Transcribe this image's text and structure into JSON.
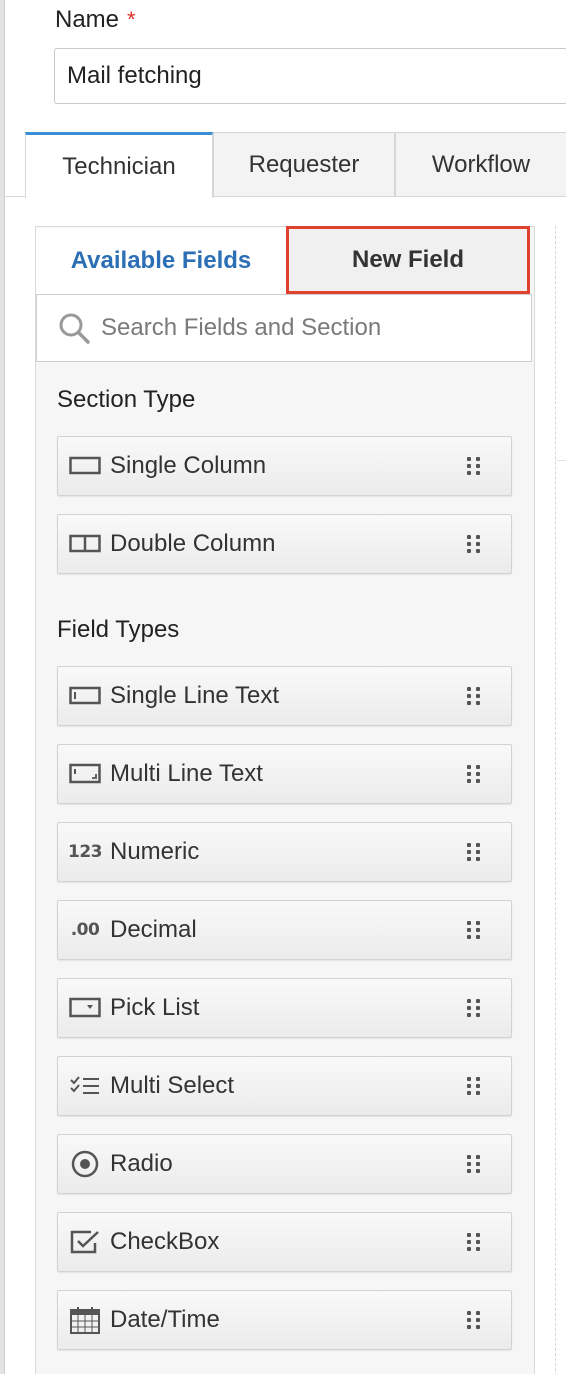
{
  "form": {
    "name_label": "Name",
    "required_marker": "*",
    "name_value": "Mail fetching"
  },
  "tabs": [
    {
      "label": "Technician",
      "active": true
    },
    {
      "label": "Requester",
      "active": false
    },
    {
      "label": "Workflow",
      "active": false
    }
  ],
  "panel": {
    "subtabs": {
      "available_fields": "Available Fields",
      "new_field": "New Field"
    },
    "highlight_color": "#e0412c",
    "link_color": "#2c6fb5",
    "search": {
      "placeholder": "Search Fields and Section"
    },
    "section_type": {
      "heading": "Section Type",
      "items": [
        {
          "label": "Single Column",
          "icon": "single-column-icon"
        },
        {
          "label": "Double Column",
          "icon": "double-column-icon"
        }
      ]
    },
    "field_types": {
      "heading": "Field Types",
      "items": [
        {
          "label": "Single Line Text",
          "icon": "single-line-text-icon"
        },
        {
          "label": "Multi Line Text",
          "icon": "multi-line-text-icon"
        },
        {
          "label": "Numeric",
          "icon": "numeric-icon",
          "icon_text": "123"
        },
        {
          "label": "Decimal",
          "icon": "decimal-icon",
          "icon_text": ".00"
        },
        {
          "label": "Pick List",
          "icon": "pick-list-icon"
        },
        {
          "label": "Multi Select",
          "icon": "multi-select-icon"
        },
        {
          "label": "Radio",
          "icon": "radio-icon"
        },
        {
          "label": "CheckBox",
          "icon": "checkbox-icon"
        },
        {
          "label": "Date/Time",
          "icon": "calendar-icon"
        }
      ]
    }
  }
}
